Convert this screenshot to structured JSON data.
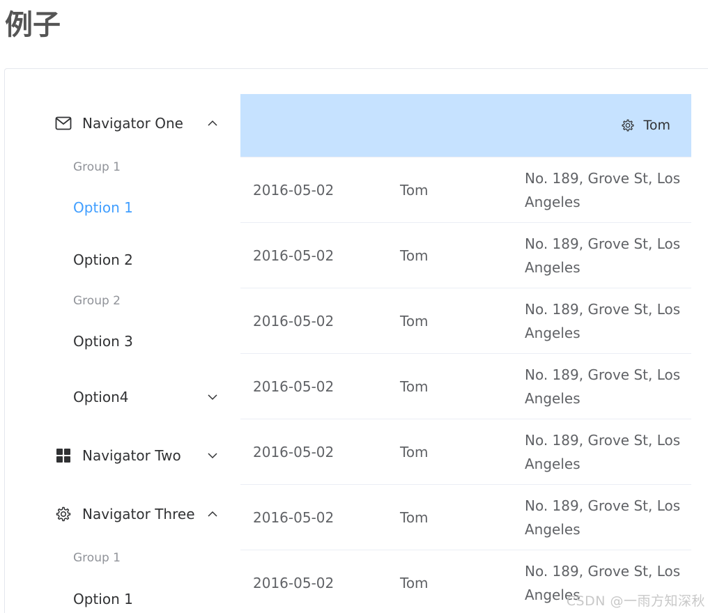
{
  "page": {
    "title": "例子"
  },
  "menu": {
    "nav1": {
      "label": "Navigator One",
      "icon": "mail-icon",
      "expanded": true,
      "group1_label": "Group 1",
      "group2_label": "Group 2",
      "options": [
        "Option 1",
        "Option 2",
        "Option 3"
      ],
      "active_option": "Option 1",
      "submenu_label": "Option4"
    },
    "nav2": {
      "label": "Navigator Two",
      "icon": "grid-icon",
      "expanded": false
    },
    "nav3": {
      "label": "Navigator Three",
      "icon": "gear-icon",
      "expanded": true,
      "group1_label": "Group 1",
      "options": [
        "Option 1"
      ]
    }
  },
  "table": {
    "header": {
      "name": "Tom",
      "icon": "gear-icon"
    },
    "rows": [
      {
        "date": "2016-05-02",
        "name": "Tom",
        "address": "No. 189, Grove St, Los Angeles"
      },
      {
        "date": "2016-05-02",
        "name": "Tom",
        "address": "No. 189, Grove St, Los Angeles"
      },
      {
        "date": "2016-05-02",
        "name": "Tom",
        "address": "No. 189, Grove St, Los Angeles"
      },
      {
        "date": "2016-05-02",
        "name": "Tom",
        "address": "No. 189, Grove St, Los Angeles"
      },
      {
        "date": "2016-05-02",
        "name": "Tom",
        "address": "No. 189, Grove St, Los Angeles"
      },
      {
        "date": "2016-05-02",
        "name": "Tom",
        "address": "No. 189, Grove St, Los Angeles"
      },
      {
        "date": "2016-05-02",
        "name": "Tom",
        "address": "No. 189, Grove St, Los Angeles"
      }
    ]
  },
  "watermark": "CSDN @一雨方知深秋",
  "colors": {
    "accent": "#409eff",
    "header_bg": "#c6e2ff",
    "text": "#303133",
    "muted": "#909399"
  }
}
